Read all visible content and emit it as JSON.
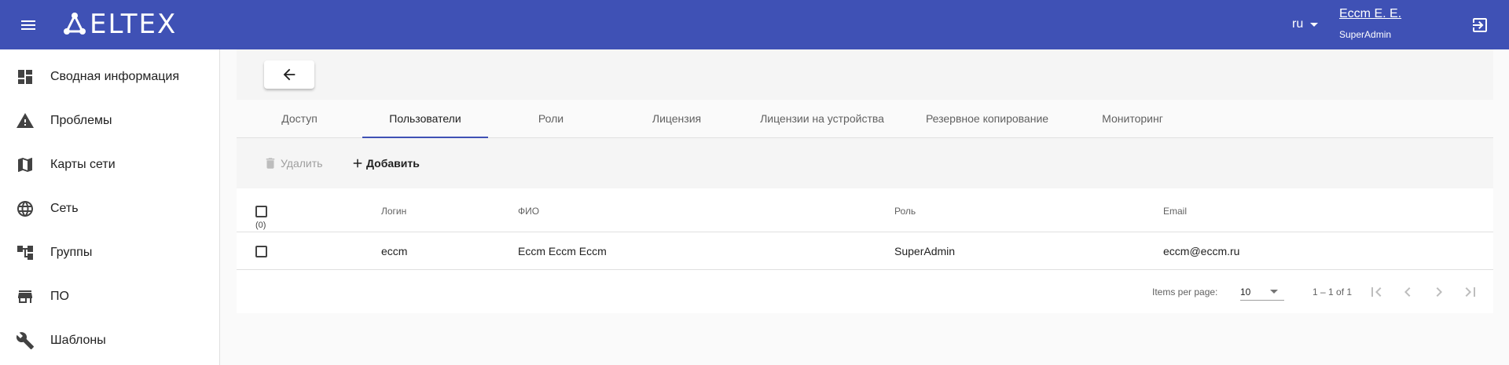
{
  "header": {
    "logo_text": "ELTEX",
    "language": "ru",
    "user_name": "Eccm E. E.",
    "user_role": "SuperAdmin",
    "accent_color": "#3f51b5"
  },
  "sidebar": {
    "items": [
      {
        "label": "Сводная информация",
        "icon": "dashboard-icon"
      },
      {
        "label": "Проблемы",
        "icon": "warning-icon"
      },
      {
        "label": "Карты сети",
        "icon": "map-icon"
      },
      {
        "label": "Сеть",
        "icon": "globe-icon"
      },
      {
        "label": "Группы",
        "icon": "groups-tree-icon"
      },
      {
        "label": "ПО",
        "icon": "store-icon"
      },
      {
        "label": "Шаблоны",
        "icon": "wrench-icon"
      }
    ]
  },
  "tabs": [
    {
      "label": "Доступ",
      "active": false
    },
    {
      "label": "Пользователи",
      "active": true
    },
    {
      "label": "Роли",
      "active": false
    },
    {
      "label": "Лицензия",
      "active": false
    },
    {
      "label": "Лицензии на устройства",
      "active": false
    },
    {
      "label": "Резервное копирование",
      "active": false
    },
    {
      "label": "Мониторинг",
      "active": false
    }
  ],
  "toolbar": {
    "delete_label": "Удалить",
    "add_label": "Добавить"
  },
  "table": {
    "selected_count": "(0)",
    "columns": [
      "Логин",
      "ФИО",
      "Роль",
      "Email"
    ],
    "rows": [
      {
        "login": "eccm",
        "fio": "Eccm Eccm Eccm",
        "role": "SuperAdmin",
        "email": "eccm@eccm.ru"
      }
    ]
  },
  "paginator": {
    "items_per_page_label": "Items per page:",
    "page_size": "10",
    "range_label": "1 – 1 of 1"
  }
}
